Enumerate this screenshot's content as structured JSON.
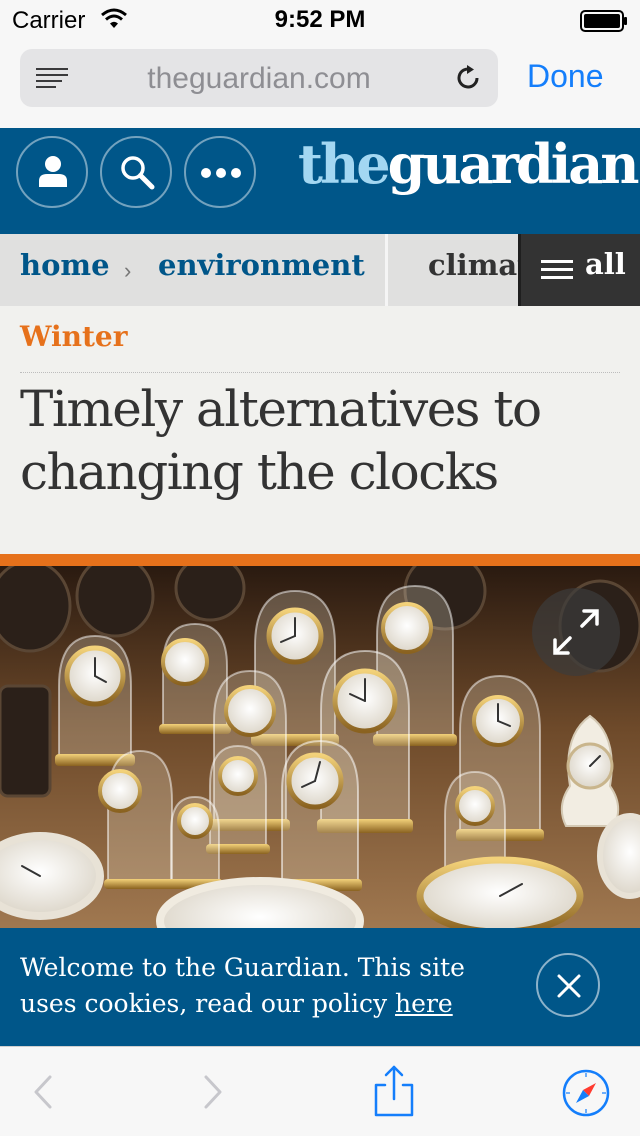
{
  "status_bar": {
    "carrier": "Carrier",
    "time": "9:52 PM",
    "icons": [
      "wifi-icon",
      "battery-icon"
    ]
  },
  "browser": {
    "url": "theguardian.com",
    "done_label": "Done",
    "accent_color": "#147efb",
    "icons": [
      "reader-icon",
      "reload-icon"
    ]
  },
  "guardian_header": {
    "logo_the": "the",
    "logo_guardian": "guardian",
    "brand_color": "#005689",
    "buttons": [
      "profile-icon",
      "search-icon",
      "more-icon"
    ]
  },
  "section_nav": {
    "home": "home",
    "separator": "›",
    "environment": "environment",
    "climate": "climate",
    "all": "all"
  },
  "article": {
    "kicker": "Winter",
    "kicker_color": "#e6711b",
    "headline": "Timely alternatives to changing the clocks"
  },
  "cookie_banner": {
    "text": "Welcome to the Guardian. This site uses cookies, read our policy ",
    "link": "here"
  },
  "toolbar": {
    "icons": [
      "back-icon",
      "forward-icon",
      "share-icon",
      "compass-icon"
    ]
  }
}
